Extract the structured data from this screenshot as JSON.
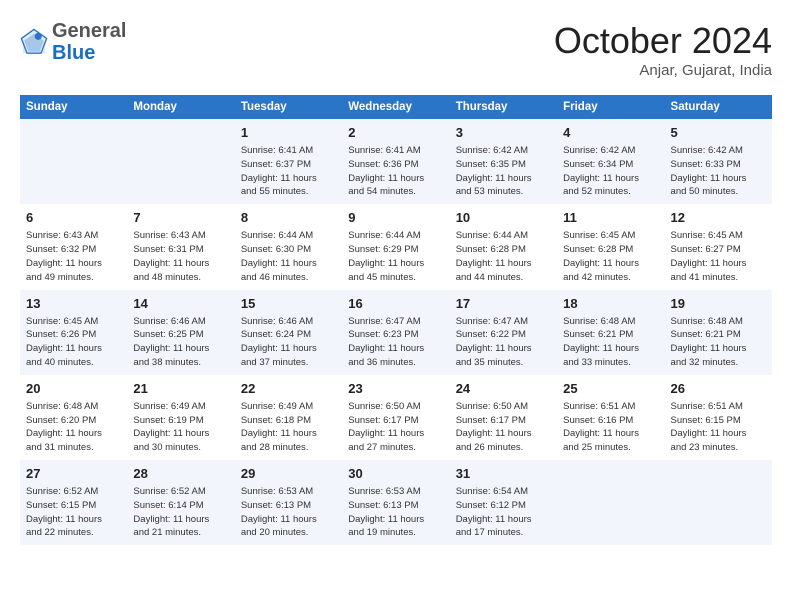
{
  "header": {
    "logo_line1": "General",
    "logo_line2": "Blue",
    "month": "October 2024",
    "location": "Anjar, Gujarat, India"
  },
  "weekdays": [
    "Sunday",
    "Monday",
    "Tuesday",
    "Wednesday",
    "Thursday",
    "Friday",
    "Saturday"
  ],
  "weeks": [
    [
      {
        "day": "",
        "info": ""
      },
      {
        "day": "",
        "info": ""
      },
      {
        "day": "1",
        "info": "Sunrise: 6:41 AM\nSunset: 6:37 PM\nDaylight: 11 hours\nand 55 minutes."
      },
      {
        "day": "2",
        "info": "Sunrise: 6:41 AM\nSunset: 6:36 PM\nDaylight: 11 hours\nand 54 minutes."
      },
      {
        "day": "3",
        "info": "Sunrise: 6:42 AM\nSunset: 6:35 PM\nDaylight: 11 hours\nand 53 minutes."
      },
      {
        "day": "4",
        "info": "Sunrise: 6:42 AM\nSunset: 6:34 PM\nDaylight: 11 hours\nand 52 minutes."
      },
      {
        "day": "5",
        "info": "Sunrise: 6:42 AM\nSunset: 6:33 PM\nDaylight: 11 hours\nand 50 minutes."
      }
    ],
    [
      {
        "day": "6",
        "info": "Sunrise: 6:43 AM\nSunset: 6:32 PM\nDaylight: 11 hours\nand 49 minutes."
      },
      {
        "day": "7",
        "info": "Sunrise: 6:43 AM\nSunset: 6:31 PM\nDaylight: 11 hours\nand 48 minutes."
      },
      {
        "day": "8",
        "info": "Sunrise: 6:44 AM\nSunset: 6:30 PM\nDaylight: 11 hours\nand 46 minutes."
      },
      {
        "day": "9",
        "info": "Sunrise: 6:44 AM\nSunset: 6:29 PM\nDaylight: 11 hours\nand 45 minutes."
      },
      {
        "day": "10",
        "info": "Sunrise: 6:44 AM\nSunset: 6:28 PM\nDaylight: 11 hours\nand 44 minutes."
      },
      {
        "day": "11",
        "info": "Sunrise: 6:45 AM\nSunset: 6:28 PM\nDaylight: 11 hours\nand 42 minutes."
      },
      {
        "day": "12",
        "info": "Sunrise: 6:45 AM\nSunset: 6:27 PM\nDaylight: 11 hours\nand 41 minutes."
      }
    ],
    [
      {
        "day": "13",
        "info": "Sunrise: 6:45 AM\nSunset: 6:26 PM\nDaylight: 11 hours\nand 40 minutes."
      },
      {
        "day": "14",
        "info": "Sunrise: 6:46 AM\nSunset: 6:25 PM\nDaylight: 11 hours\nand 38 minutes."
      },
      {
        "day": "15",
        "info": "Sunrise: 6:46 AM\nSunset: 6:24 PM\nDaylight: 11 hours\nand 37 minutes."
      },
      {
        "day": "16",
        "info": "Sunrise: 6:47 AM\nSunset: 6:23 PM\nDaylight: 11 hours\nand 36 minutes."
      },
      {
        "day": "17",
        "info": "Sunrise: 6:47 AM\nSunset: 6:22 PM\nDaylight: 11 hours\nand 35 minutes."
      },
      {
        "day": "18",
        "info": "Sunrise: 6:48 AM\nSunset: 6:21 PM\nDaylight: 11 hours\nand 33 minutes."
      },
      {
        "day": "19",
        "info": "Sunrise: 6:48 AM\nSunset: 6:21 PM\nDaylight: 11 hours\nand 32 minutes."
      }
    ],
    [
      {
        "day": "20",
        "info": "Sunrise: 6:48 AM\nSunset: 6:20 PM\nDaylight: 11 hours\nand 31 minutes."
      },
      {
        "day": "21",
        "info": "Sunrise: 6:49 AM\nSunset: 6:19 PM\nDaylight: 11 hours\nand 30 minutes."
      },
      {
        "day": "22",
        "info": "Sunrise: 6:49 AM\nSunset: 6:18 PM\nDaylight: 11 hours\nand 28 minutes."
      },
      {
        "day": "23",
        "info": "Sunrise: 6:50 AM\nSunset: 6:17 PM\nDaylight: 11 hours\nand 27 minutes."
      },
      {
        "day": "24",
        "info": "Sunrise: 6:50 AM\nSunset: 6:17 PM\nDaylight: 11 hours\nand 26 minutes."
      },
      {
        "day": "25",
        "info": "Sunrise: 6:51 AM\nSunset: 6:16 PM\nDaylight: 11 hours\nand 25 minutes."
      },
      {
        "day": "26",
        "info": "Sunrise: 6:51 AM\nSunset: 6:15 PM\nDaylight: 11 hours\nand 23 minutes."
      }
    ],
    [
      {
        "day": "27",
        "info": "Sunrise: 6:52 AM\nSunset: 6:15 PM\nDaylight: 11 hours\nand 22 minutes."
      },
      {
        "day": "28",
        "info": "Sunrise: 6:52 AM\nSunset: 6:14 PM\nDaylight: 11 hours\nand 21 minutes."
      },
      {
        "day": "29",
        "info": "Sunrise: 6:53 AM\nSunset: 6:13 PM\nDaylight: 11 hours\nand 20 minutes."
      },
      {
        "day": "30",
        "info": "Sunrise: 6:53 AM\nSunset: 6:13 PM\nDaylight: 11 hours\nand 19 minutes."
      },
      {
        "day": "31",
        "info": "Sunrise: 6:54 AM\nSunset: 6:12 PM\nDaylight: 11 hours\nand 17 minutes."
      },
      {
        "day": "",
        "info": ""
      },
      {
        "day": "",
        "info": ""
      }
    ]
  ]
}
